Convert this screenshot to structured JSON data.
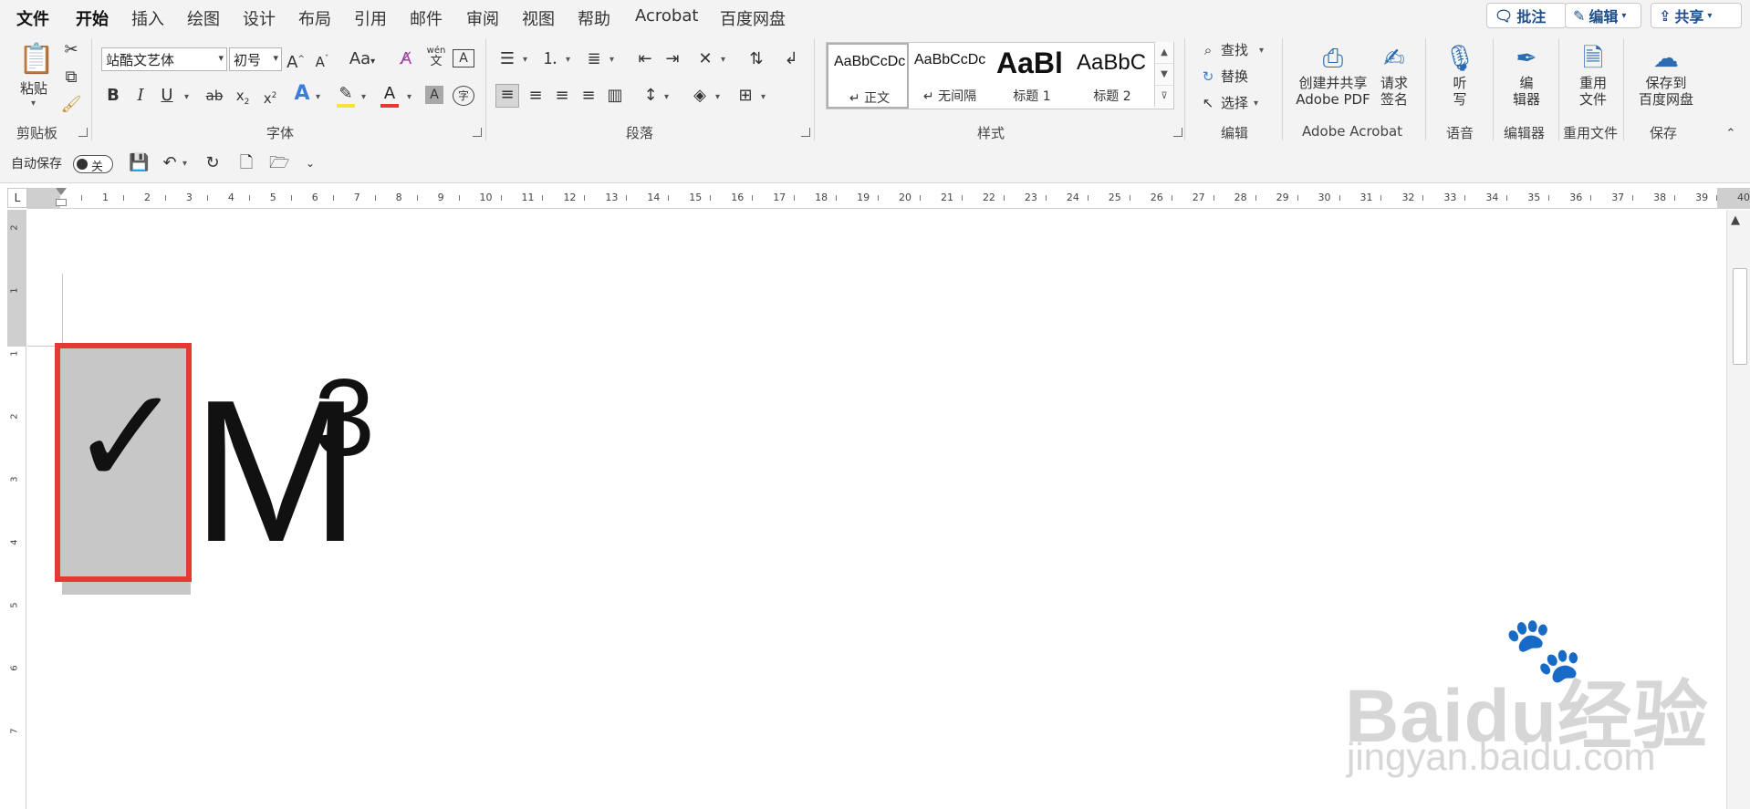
{
  "tabs": [
    "文件",
    "开始",
    "插入",
    "绘图",
    "设计",
    "布局",
    "引用",
    "邮件",
    "审阅",
    "视图",
    "帮助",
    "Acrobat",
    "百度网盘"
  ],
  "top_buttons": {
    "comment": "批注",
    "edit": "编辑",
    "share": "共享"
  },
  "clipboard": {
    "paste": "粘贴",
    "group": "剪贴板"
  },
  "font": {
    "name": "站酷文艺体",
    "size": "初号",
    "group": "字体",
    "pinyin_top": "wén",
    "pinyin_bottom": "文"
  },
  "paragraph": {
    "group": "段落"
  },
  "styles": {
    "group": "样式",
    "items": [
      {
        "preview": "AaBbCcDc",
        "name": "↵ 正文"
      },
      {
        "preview": "AaBbCcDc",
        "name": "↵ 无间隔"
      },
      {
        "preview": "AaBl",
        "name": "标题 1"
      },
      {
        "preview": "AaBbC",
        "name": "标题 2"
      }
    ]
  },
  "editing": {
    "find": "查找",
    "replace": "替换",
    "select": "选择",
    "group": "编辑"
  },
  "acrobat": {
    "create_share_1": "创建并共享",
    "create_share_2": "Adobe PDF",
    "request_sign_1": "请求",
    "request_sign_2": "签名",
    "group": "Adobe Acrobat"
  },
  "voice": {
    "dictate_1": "听",
    "dictate_2": "写",
    "group": "语音"
  },
  "editor": {
    "label_1": "编",
    "label_2": "辑器",
    "group": "编辑器"
  },
  "reuse": {
    "label_1": "重用",
    "label_2": "文件",
    "group": "重用文件"
  },
  "save": {
    "label_1": "保存到",
    "label_2": "百度网盘",
    "group": "保存"
  },
  "qat": {
    "autosave": "自动保存",
    "autosave_state": "关"
  },
  "ruler": {
    "ticks": [
      "1",
      "2",
      "3",
      "4",
      "5",
      "6",
      "7",
      "8",
      "9",
      "10",
      "11",
      "12",
      "13",
      "14",
      "15",
      "16",
      "17",
      "18",
      "19",
      "20",
      "21",
      "22",
      "23",
      "24",
      "25",
      "26",
      "27",
      "28",
      "29",
      "30",
      "31",
      "32",
      "33",
      "34",
      "35",
      "36",
      "37",
      "38",
      "39",
      "40"
    ],
    "vticks": [
      "2",
      "1",
      "1",
      "2",
      "3",
      "4",
      "5",
      "6",
      "7"
    ],
    "corner": "L"
  },
  "document": {
    "checkmark": "✓",
    "letter": "M",
    "superscript": "3"
  },
  "watermark": {
    "brand": "Baidu经验",
    "url": "jingyan.baidu.com"
  },
  "colors": {
    "accent": "#2b579a",
    "selection_border": "#e53935",
    "selection_fill": "#c7c7c7",
    "font_color_bar": "#e53935",
    "highlight_bar": "#f7e23c"
  }
}
